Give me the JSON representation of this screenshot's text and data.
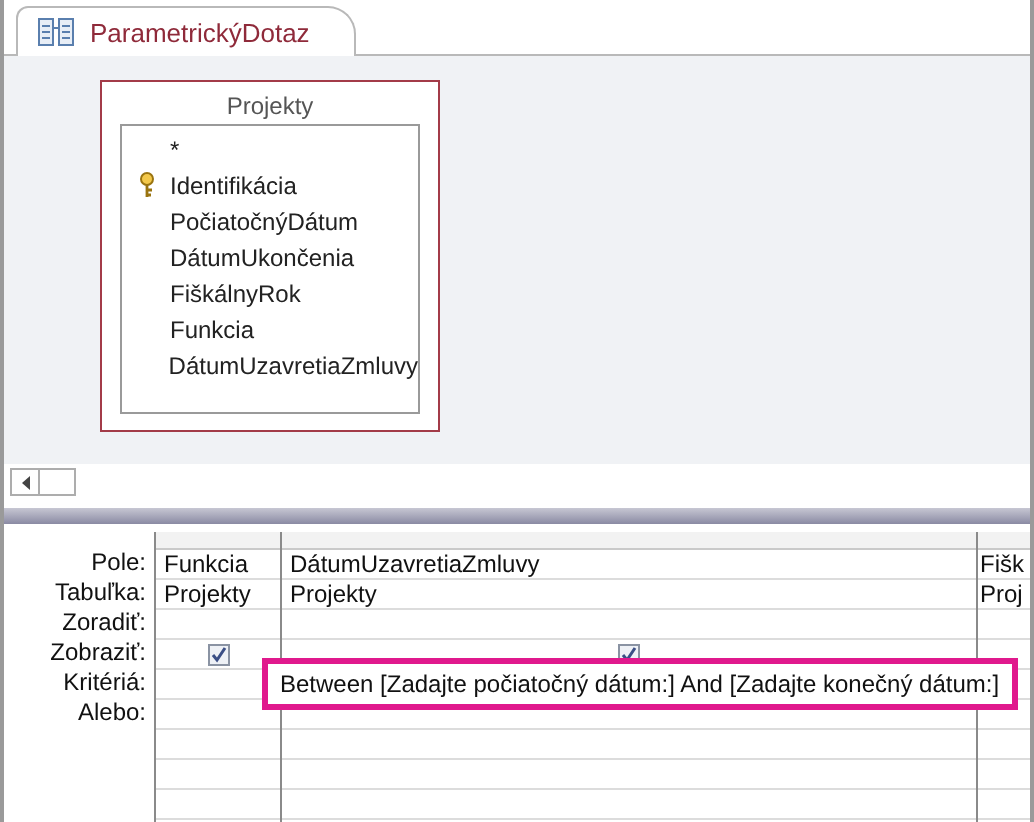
{
  "tab": {
    "title": "ParametrickýDotaz",
    "selected": true
  },
  "table_box": {
    "title": "Projekty",
    "fields": [
      {
        "name": "*",
        "primary_key": false
      },
      {
        "name": "Identifikácia",
        "primary_key": true
      },
      {
        "name": "PočiatočnýDátum",
        "primary_key": false
      },
      {
        "name": "DátumUkončenia",
        "primary_key": false
      },
      {
        "name": "FiškálnyRok",
        "primary_key": false
      },
      {
        "name": "Funkcia",
        "primary_key": false
      },
      {
        "name": "DátumUzavretiaZmluvy",
        "primary_key": false
      }
    ]
  },
  "row_labels": [
    "Pole:",
    "Tabuľka:",
    "Zoradiť:",
    "Zobraziť:",
    "Kritériá:",
    "Alebo:"
  ],
  "columns": [
    {
      "field": "Funkcia",
      "table": "Projekty",
      "show": true
    },
    {
      "field": "DátumUzavretiaZmluvy",
      "table": "Projekty",
      "show": true,
      "criteria": "Between [Zadajte počiatočný dátum:] And [Zadajte konečný dátum:]",
      "criteria_highlighted": true
    },
    {
      "field": "Fišk",
      "table": "Proj"
    }
  ]
}
